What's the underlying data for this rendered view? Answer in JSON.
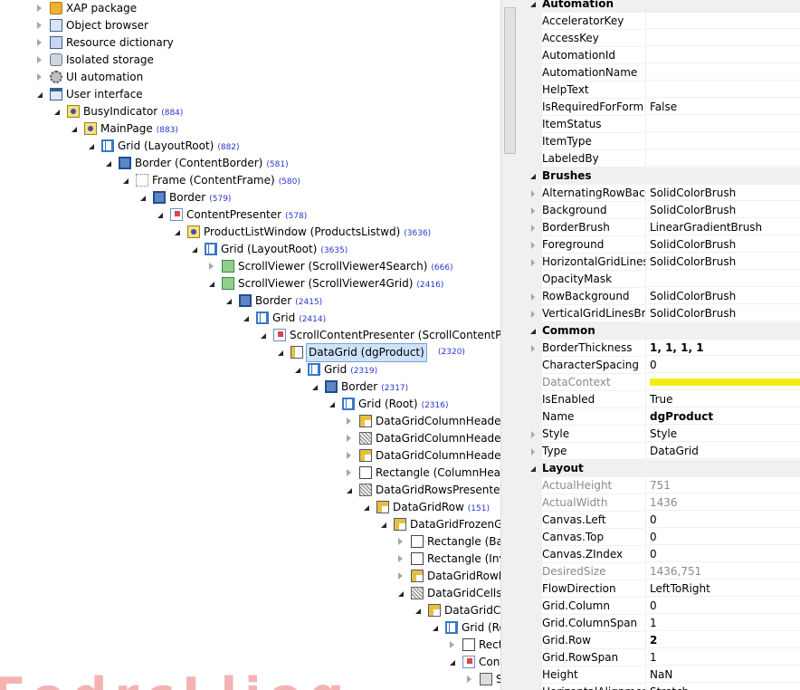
{
  "tree": [
    {
      "label": "XAP package",
      "icon": "package-icon",
      "expanded": false
    },
    {
      "label": "Object browser",
      "icon": "object-browser-icon",
      "expanded": false
    },
    {
      "label": "Resource dictionary",
      "icon": "resource-dictionary-icon",
      "expanded": false
    },
    {
      "label": "Isolated storage",
      "icon": "isolated-storage-icon",
      "expanded": false
    },
    {
      "label": "UI automation",
      "icon": "gear-icon",
      "expanded": false
    },
    {
      "label": "User interface",
      "icon": "user-interface-icon",
      "expanded": true
    },
    {
      "label": "BusyIndicator",
      "count": "(884)",
      "icon": "control-icon",
      "expanded": true
    },
    {
      "label": "MainPage",
      "count": "(883)",
      "icon": "control-icon",
      "expanded": true
    },
    {
      "label": "Grid (LayoutRoot)",
      "count": "(882)",
      "icon": "grid-icon",
      "expanded": true
    },
    {
      "label": "Border (ContentBorder)",
      "count": "(581)",
      "icon": "border-icon",
      "expanded": true
    },
    {
      "label": "Frame (ContentFrame)",
      "count": "(580)",
      "icon": "frame-icon",
      "expanded": true
    },
    {
      "label": "Border",
      "count": "(579)",
      "icon": "border-icon",
      "expanded": true
    },
    {
      "label": "ContentPresenter",
      "count": "(578)",
      "icon": "content-presenter-icon",
      "expanded": true
    },
    {
      "label": "ProductListWindow (ProductsListwd)",
      "count": "(3636)",
      "icon": "control-icon",
      "expanded": true
    },
    {
      "label": "Grid (LayoutRoot)",
      "count": "(3635)",
      "icon": "grid-icon",
      "expanded": true
    },
    {
      "label": "ScrollViewer (ScrollViewer4Search)",
      "count": "(666)",
      "icon": "scroll-viewer-icon",
      "expanded": false
    },
    {
      "label": "ScrollViewer (ScrollViewer4Grid)",
      "count": "(2416)",
      "icon": "scroll-viewer-icon",
      "expanded": true
    },
    {
      "label": "Border",
      "count": "(2415)",
      "icon": "border-icon",
      "expanded": true
    },
    {
      "label": "Grid",
      "count": "(2414)",
      "icon": "grid-icon",
      "expanded": true
    },
    {
      "label": "ScrollContentPresenter (ScrollContentPresenter)",
      "count": "",
      "icon": "content-presenter-icon",
      "expanded": true
    },
    {
      "label": "DataGrid (dgProduct)",
      "count": "(2320)",
      "icon": "datagrid-icon",
      "expanded": true,
      "selected": true
    },
    {
      "label": "Grid",
      "count": "(2319)",
      "icon": "grid-icon",
      "expanded": true
    },
    {
      "label": "Border",
      "count": "(2317)",
      "icon": "border-icon",
      "expanded": true
    },
    {
      "label": "Grid (Root)",
      "count": "(2316)",
      "icon": "grid-icon",
      "expanded": true
    },
    {
      "label": "DataGridColumnHeader (TopLeftCornerHeader)",
      "count": "",
      "icon": "datagrid-header-icon",
      "expanded": false
    },
    {
      "label": "DataGridColumnHeadersPresenter (ColumnHeadersPresenter)",
      "count": "",
      "icon": "hatch-icon",
      "expanded": false
    },
    {
      "label": "DataGridColumnHeader (TopRightCornerHeader)",
      "count": "",
      "icon": "datagrid-header-icon",
      "expanded": false
    },
    {
      "label": "Rectangle (ColumnHeadersAndRowsSeparator)",
      "count": "",
      "icon": "rectangle-icon",
      "expanded": false
    },
    {
      "label": "DataGridRowsPresenter (RowsPresenter)",
      "count": "",
      "icon": "hatch-icon",
      "expanded": true
    },
    {
      "label": "DataGridRow",
      "count": "(151)",
      "icon": "datagrid-header-icon",
      "expanded": true
    },
    {
      "label": "DataGridFrozenGrid (Root)",
      "count": "",
      "icon": "datagrid-header-icon",
      "expanded": true
    },
    {
      "label": "Rectangle (BackgroundRectangle)",
      "count": "",
      "icon": "rectangle-icon",
      "expanded": false
    },
    {
      "label": "Rectangle (InvalidVisualElement)",
      "count": "",
      "icon": "rectangle-icon",
      "expanded": false
    },
    {
      "label": "DataGridRowHeader (RowHeader)",
      "count": "",
      "icon": "datagrid-header-icon",
      "expanded": false
    },
    {
      "label": "DataGridCellsPresenter (CellsPresenter)",
      "count": "",
      "icon": "hatch-icon",
      "expanded": true
    },
    {
      "label": "DataGridCell",
      "count": "",
      "icon": "datagrid-header-icon",
      "expanded": true
    },
    {
      "label": "Grid (Root)",
      "count": "",
      "icon": "grid-icon",
      "expanded": true
    },
    {
      "label": "Rectangle",
      "count": "",
      "icon": "rectangle-icon",
      "expanded": false
    },
    {
      "label": "ContentPresenter",
      "count": "",
      "icon": "content-presenter-icon",
      "expanded": true
    },
    {
      "label": "S",
      "count": "",
      "icon": "small-icon",
      "expanded": false
    }
  ],
  "properties": [
    {
      "category": "Automation"
    },
    {
      "name": "AcceleratorKey",
      "value": ""
    },
    {
      "name": "AccessKey",
      "value": ""
    },
    {
      "name": "AutomationId",
      "value": ""
    },
    {
      "name": "AutomationName",
      "value": ""
    },
    {
      "name": "HelpText",
      "value": ""
    },
    {
      "name": "IsRequiredForForm",
      "value": "False"
    },
    {
      "name": "ItemStatus",
      "value": ""
    },
    {
      "name": "ItemType",
      "value": ""
    },
    {
      "name": "LabeledBy",
      "value": ""
    },
    {
      "category": "Brushes"
    },
    {
      "name": "AlternatingRowBackground",
      "value": "SolidColorBrush",
      "expandable": true
    },
    {
      "name": "Background",
      "value": "SolidColorBrush",
      "expandable": true
    },
    {
      "name": "BorderBrush",
      "value": "LinearGradientBrush",
      "expandable": true
    },
    {
      "name": "Foreground",
      "value": "SolidColorBrush",
      "expandable": true
    },
    {
      "name": "HorizontalGridLinesBrush",
      "value": "SolidColorBrush",
      "expandable": true
    },
    {
      "name": "OpacityMask",
      "value": ""
    },
    {
      "name": "RowBackground",
      "value": "SolidColorBrush",
      "expandable": true
    },
    {
      "name": "VerticalGridLinesBrush",
      "value": "SolidColorBrush",
      "expandable": true
    },
    {
      "category": "Common"
    },
    {
      "name": "BorderThickness",
      "value": "1, 1, 1, 1",
      "expandable": true,
      "bold": true
    },
    {
      "name": "CharacterSpacing",
      "value": "0"
    },
    {
      "name": "DataContext",
      "value": "",
      "readonly": true,
      "highlighted": true
    },
    {
      "name": "IsEnabled",
      "value": "True"
    },
    {
      "name": "Name",
      "value": "dgProduct",
      "bold": true
    },
    {
      "name": "Style",
      "value": "Style",
      "expandable": true
    },
    {
      "name": "Type",
      "value": "DataGrid",
      "expandable": true
    },
    {
      "category": "Layout"
    },
    {
      "name": "ActualHeight",
      "value": "751",
      "readonly": true
    },
    {
      "name": "ActualWidth",
      "value": "1436",
      "readonly": true
    },
    {
      "name": "Canvas.Left",
      "value": "0"
    },
    {
      "name": "Canvas.Top",
      "value": "0"
    },
    {
      "name": "Canvas.ZIndex",
      "value": "0"
    },
    {
      "name": "DesiredSize",
      "value": "1436,751",
      "readonly": true
    },
    {
      "name": "FlowDirection",
      "value": "LeftToRight"
    },
    {
      "name": "Grid.Column",
      "value": "0"
    },
    {
      "name": "Grid.ColumnSpan",
      "value": "1"
    },
    {
      "name": "Grid.Row",
      "value": "2",
      "bold": true
    },
    {
      "name": "Grid.RowSpan",
      "value": "1"
    },
    {
      "name": "Height",
      "value": "NaN"
    },
    {
      "name": "HorizontalAlignment",
      "value": "Stretch"
    }
  ]
}
